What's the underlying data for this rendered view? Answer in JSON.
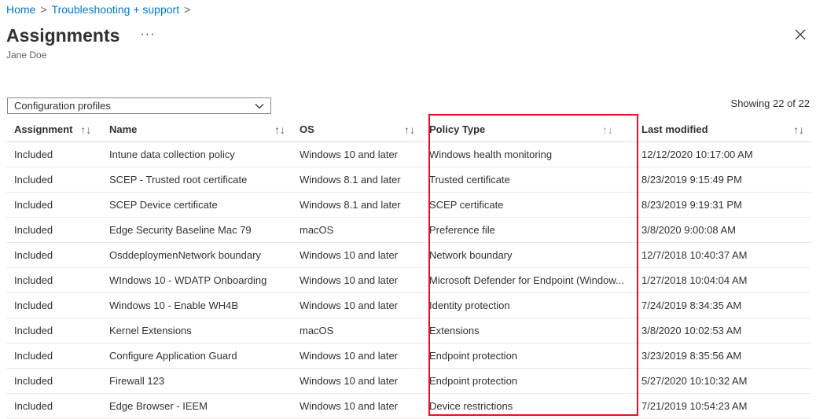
{
  "breadcrumb": {
    "items": [
      "Home",
      "Troubleshooting + support"
    ],
    "sep": ">"
  },
  "header": {
    "title": "Assignments",
    "more": "···",
    "subtitle": "Jane Doe"
  },
  "filter": {
    "selected": "Configuration profiles"
  },
  "count_text": "Showing 22 of 22",
  "table": {
    "columns": [
      "Assignment",
      "Name",
      "OS",
      "Policy Type",
      "Last modified"
    ],
    "sort_glyph": "↑↓",
    "rows": [
      [
        "Included",
        "Intune data collection policy",
        "Windows 10 and later",
        "Windows health monitoring",
        "12/12/2020 10:17:00 AM"
      ],
      [
        "Included",
        "SCEP - Trusted root certificate",
        "Windows 8.1 and later",
        "Trusted certificate",
        "8/23/2019 9:15:49 PM"
      ],
      [
        "Included",
        "SCEP Device certificate",
        "Windows 8.1 and later",
        "SCEP certificate",
        "8/23/2019 9:19:31 PM"
      ],
      [
        "Included",
        "Edge Security Baseline Mac 79",
        "macOS",
        "Preference file",
        "3/8/2020 9:00:08 AM"
      ],
      [
        "Included",
        "OsddeploymenNetwork boundary",
        "Windows 10 and later",
        "Network boundary",
        "12/7/2018 10:40:37 AM"
      ],
      [
        "Included",
        "WIndows 10 - WDATP Onboarding",
        "Windows 10 and later",
        "Microsoft Defender for Endpoint (Window...",
        "1/27/2018 10:04:04 AM"
      ],
      [
        "Included",
        "Windows 10 - Enable WH4B",
        "Windows 10 and later",
        "Identity protection",
        "7/24/2019 8:34:35 AM"
      ],
      [
        "Included",
        "Kernel Extensions",
        "macOS",
        "Extensions",
        "3/8/2020 10:02:53 AM"
      ],
      [
        "Included",
        "Configure Application Guard",
        "Windows 10 and later",
        "Endpoint protection",
        "3/23/2019 8:35:56 AM"
      ],
      [
        "Included",
        "Firewall 123",
        "Windows 10 and later",
        "Endpoint protection",
        "5/27/2020 10:10:32 AM"
      ],
      [
        "Included",
        "Edge Browser - IEEM",
        "Windows 10 and later",
        "Device restrictions",
        "7/21/2019 10:54:23 AM"
      ]
    ]
  },
  "icons": {
    "close": "close-icon",
    "dropdown": "chevron-down-icon",
    "sort": "sort-icon"
  },
  "colors": {
    "link": "#0078d4",
    "highlight": "#e81123",
    "text": "#323130"
  }
}
